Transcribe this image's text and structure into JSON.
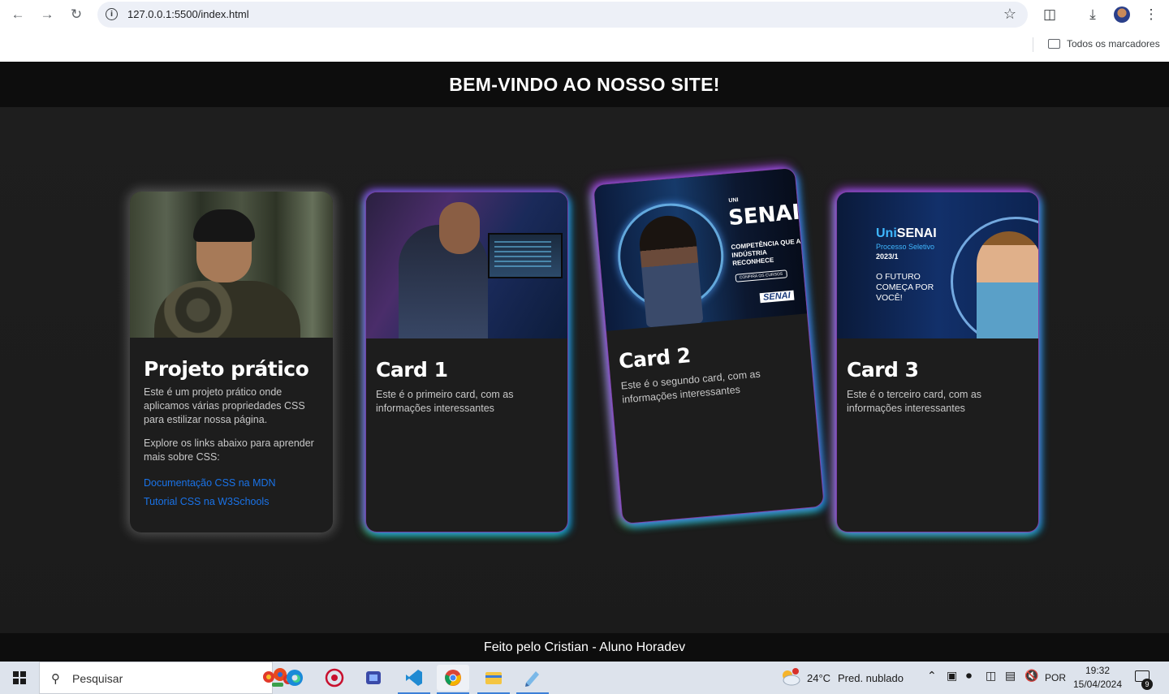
{
  "browser": {
    "url": "127.0.0.1:5500/index.html",
    "bookmarks_label": "Todos os marcadores"
  },
  "site": {
    "header_title": "BEM-VINDO AO NOSSO SITE!",
    "footer_text": "Feito pelo Cristian - Aluno Horadev"
  },
  "cards": [
    {
      "title": "Projeto prático",
      "text": "Este é um projeto prático onde aplicamos várias propriedades CSS para estilizar nossa página.",
      "text2": "Explore os links abaixo para aprender mais sobre CSS:",
      "links": [
        "Documentação CSS na MDN",
        "Tutorial CSS na W3Schools"
      ]
    },
    {
      "title": "Card 1",
      "text": "Este é o primeiro card, com as informações interessantes"
    },
    {
      "title": "Card 2",
      "text": "Este é o segundo card, com as informações interessantes",
      "image_text": {
        "uni": "UNI",
        "brand": "SENAI",
        "tagline": "COMPETÊNCIA QUE A INDÚSTRIA RECONHECE",
        "cta": "CONFIRA OS CURSOS",
        "logo": "SENAI"
      }
    },
    {
      "title": "Card 3",
      "text": "Este é o terceiro card, com as informações interessantes",
      "image_text": {
        "brand_prefix": "Uni",
        "brand": "SENAI",
        "subtitle": "Processo Seletivo",
        "year": "2023/1",
        "slogan": "O FUTURO COMEÇA POR VOCÊ!"
      }
    }
  ],
  "taskbar": {
    "search_label": "Pesquisar",
    "weather_temp": "24°C",
    "weather_desc": "Pred. nublado",
    "language": "POR",
    "time": "19:32",
    "date": "15/04/2024",
    "notification_count": "9"
  }
}
